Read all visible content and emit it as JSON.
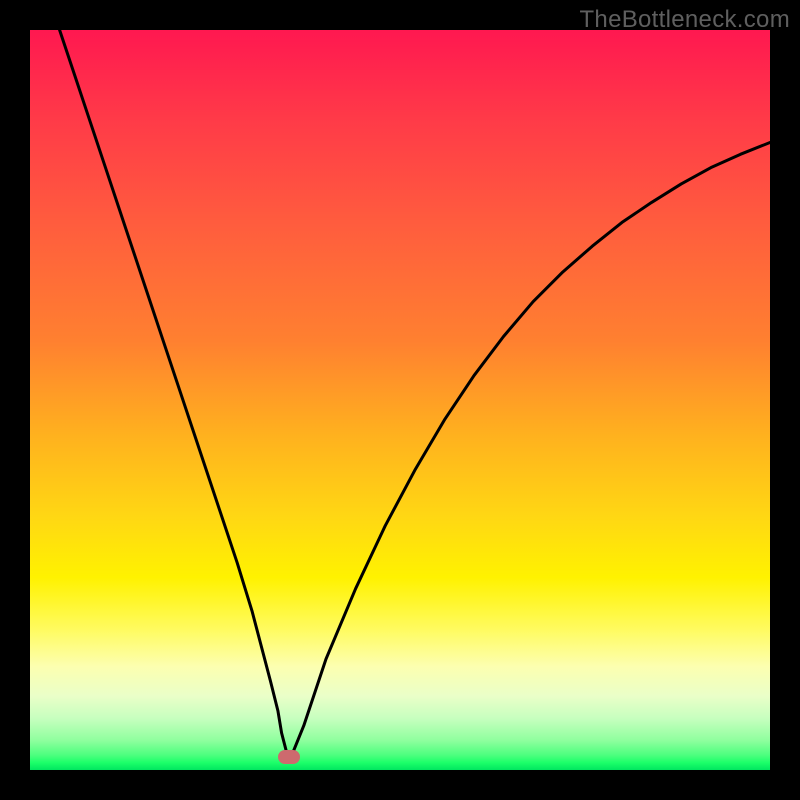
{
  "watermark": "TheBottleneck.com",
  "chart_data": {
    "type": "line",
    "title": "",
    "xlabel": "",
    "ylabel": "",
    "xlim": [
      0,
      100
    ],
    "ylim": [
      0,
      100
    ],
    "grid": false,
    "legend": false,
    "series": [
      {
        "name": "curve",
        "x": [
          4,
          6,
          8,
          10,
          12,
          14,
          16,
          18,
          20,
          22,
          24,
          26,
          28,
          30,
          32.5,
          33.5,
          34,
          34.7,
          35.5,
          37,
          40,
          44,
          48,
          52,
          56,
          60,
          64,
          68,
          72,
          76,
          80,
          84,
          88,
          92,
          96,
          100
        ],
        "y": [
          100,
          94,
          88,
          82,
          76,
          70,
          64,
          58,
          52,
          46,
          40,
          34,
          28,
          21.5,
          12,
          8,
          5,
          2.3,
          2.3,
          6,
          15,
          24.5,
          33,
          40.5,
          47.3,
          53.3,
          58.6,
          63.3,
          67.3,
          70.8,
          74,
          76.7,
          79.2,
          81.4,
          83.2,
          84.8
        ]
      }
    ],
    "marker": {
      "x": 35,
      "y": 1.8
    },
    "gradient_stops": [
      {
        "pos": 0,
        "color": "#ff1850"
      },
      {
        "pos": 50,
        "color": "#ff8a2a"
      },
      {
        "pos": 75,
        "color": "#fff200"
      },
      {
        "pos": 100,
        "color": "#00e660"
      }
    ]
  }
}
